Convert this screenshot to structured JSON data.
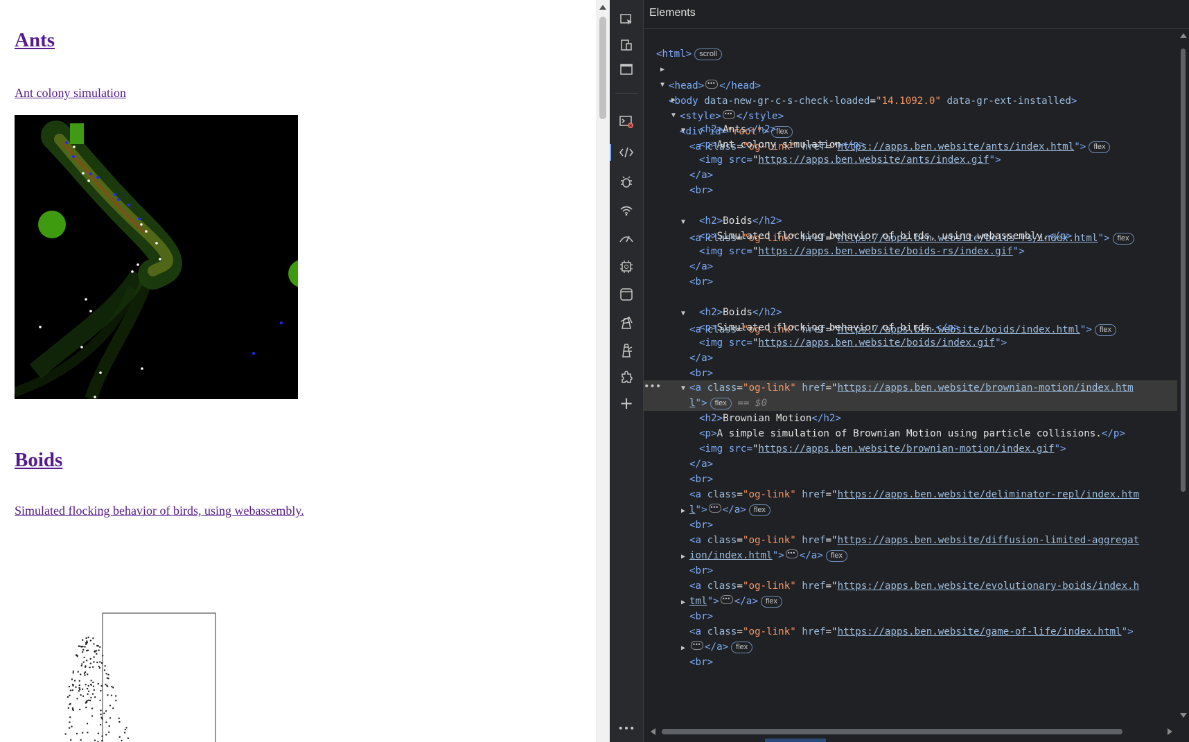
{
  "page": {
    "items": [
      {
        "title": "Ants",
        "description": "Ant colony simulation"
      },
      {
        "title": "Boids",
        "description": "Simulated flocking behavior of birds, using webassembly."
      }
    ]
  },
  "devtools": {
    "panel_title": "Elements",
    "active_tool": "elements-icon",
    "tools": [
      "inspect-element-icon",
      "device-toolbar-icon",
      "page-icon",
      "console-icon",
      "elements-icon",
      "sources-icon",
      "network-icon",
      "performance-icon",
      "memory-icon",
      "application-icon",
      "lighthouse-icon",
      "recorder-icon",
      "extensions-icon",
      "add-tool-icon",
      "more-tools-icon"
    ],
    "badges": {
      "scroll": "scroll",
      "flex": "flex"
    },
    "selected_marker": "== $0",
    "rows_text": {
      "html_open": "<html>",
      "head": "<head>",
      "head_close": "</head>",
      "body_open": "<body",
      "body_attr1": "data-new-gr-c-s-check-loaded",
      "body_attr1_val": "\"14.1092.0\"",
      "body_attr2": "data-gr-ext-installed",
      "style_open": "<style>",
      "style_close": "</style>",
      "div_root_open": "<div id=",
      "div_root_val": "\"root\"",
      "br": "<br>",
      "a_close": "</a>",
      "a_class_val": "\"og-link\"",
      "h2_open": "<h2>",
      "h2_close": "</h2>",
      "p_open": "<p>",
      "p_close": "</p>",
      "img_src": "<img src=",
      "gt": "\">"
    },
    "links": [
      {
        "href": "https://apps.ben.website/ants/index.html",
        "h2": "Ants",
        "p": "Ant colony simulation",
        "img": "https://apps.ben.website/ants/index.gif"
      },
      {
        "href": "https://apps.ben.website/boids-rs/index.html",
        "h2": "Boids",
        "p": "Simulated flocking behavior of birds, using webassembly.",
        "img": "https://apps.ben.website/boids-rs/index.gif"
      },
      {
        "href": "https://apps.ben.website/boids/index.html",
        "h2": "Boids",
        "p": "Simulated flocking behavior of birds.",
        "img": "https://apps.ben.website/boids/index.gif"
      },
      {
        "href_a": "https://apps.ben.website/brownian-motion/index.htm",
        "href_b": "l",
        "h2": "Brownian Motion",
        "p": "A simple simulation of Brownian Motion using particle collisions.",
        "img": "https://apps.ben.website/brownian-motion/index.gif"
      },
      {
        "href_a": "https://apps.ben.website/deliminator-repl/index.htm",
        "href_b": "l"
      },
      {
        "href_a": "https://apps.ben.website/diffusion-limited-aggregat",
        "href_b": "ion/index.html"
      },
      {
        "href_a": "https://apps.ben.website/evolutionary-boids/index.h",
        "href_b": "tml"
      },
      {
        "href": "https://apps.ben.website/game-of-life/index.html"
      }
    ]
  }
}
